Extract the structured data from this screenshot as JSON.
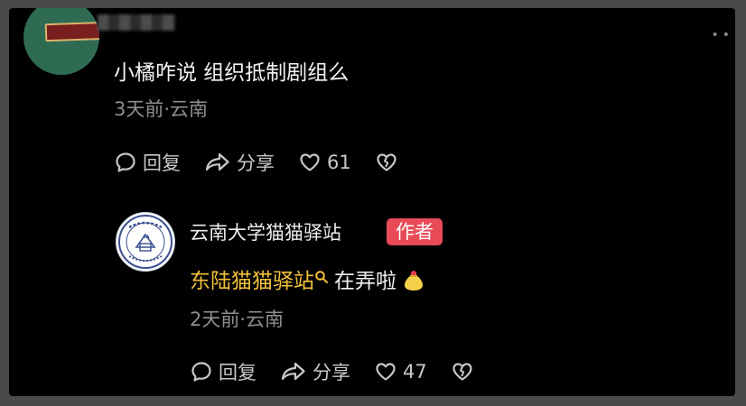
{
  "comment": {
    "text": "小橘咋说 组织抵制剧组么",
    "meta": "3天前·云南",
    "actions": {
      "reply_label": "回复",
      "share_label": "分享",
      "like_count": "61"
    }
  },
  "reply": {
    "author": "云南大学猫猫驿站",
    "badge": "作者",
    "link_text": "东陆猫猫驿站",
    "text_after": "在弄啦",
    "meta": "2天前·云南",
    "actions": {
      "reply_label": "回复",
      "share_label": "分享",
      "like_count": "47"
    }
  },
  "colors": {
    "background": "#000000",
    "link": "#f2c23a",
    "badge": "#e84a57"
  },
  "icons": [
    "comment-bubble-icon",
    "share-arrow-icon",
    "heart-icon",
    "broken-heart-icon",
    "search-icon",
    "lucky-bag-emoji"
  ]
}
